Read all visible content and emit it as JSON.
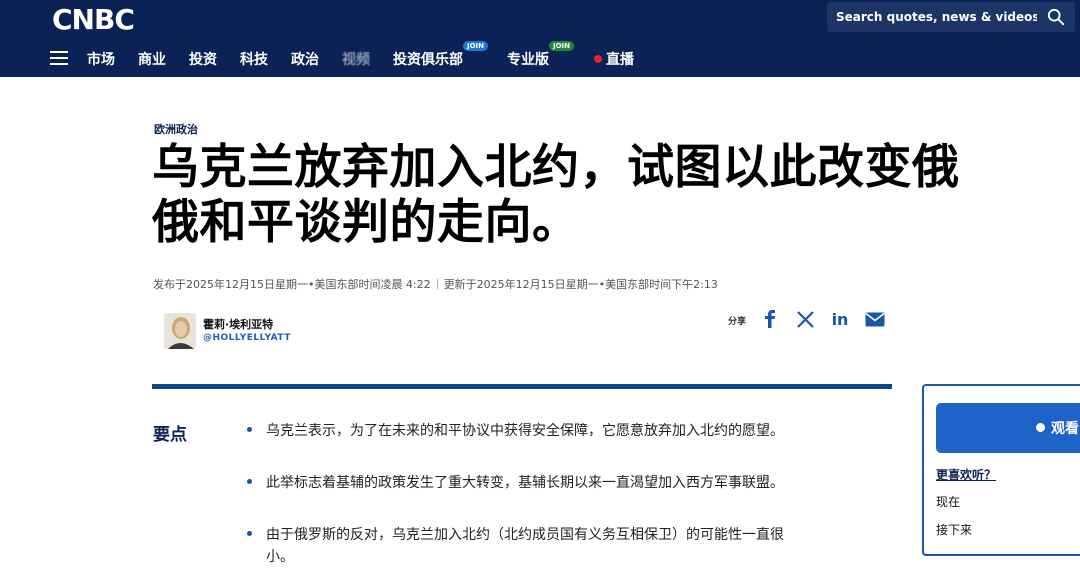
{
  "header": {
    "logo": "CNBC",
    "search_placeholder": "Search quotes, news & videos",
    "nav": [
      {
        "label": "市场"
      },
      {
        "label": "商业"
      },
      {
        "label": "投资"
      },
      {
        "label": "科技"
      },
      {
        "label": "政治"
      },
      {
        "label": "视频"
      },
      {
        "label": "投资俱乐部",
        "badge": "JOIN"
      },
      {
        "label": "专业版",
        "badge": "JOIN"
      },
      {
        "label": "直播"
      }
    ]
  },
  "article": {
    "category": "欧洲政治",
    "headline_line1": "乌克兰放弃加入北约，试图以此改变俄",
    "headline_line2": "俄和平谈判的走向。",
    "published": "发布于2025年12月15日星期一•美国东部时间凌晨 4:22",
    "updated": "更新于2025年12月15日星期一•美国东部时间下午2:13",
    "author_name": "霍莉·埃利亚特",
    "author_handle": "@HOLLYELLYATT",
    "share_label": "分享",
    "share_icons": [
      "facebook-icon",
      "x-icon",
      "linkedin-icon",
      "email-icon"
    ],
    "key_points_label": "要点",
    "key_points": [
      "乌克兰表示，为了在未来的和平协议中获得安全保障，它愿意放弃加入北约的愿望。",
      "此举标志着基辅的政策发生了重大转变，基辅长期以来一直渴望加入西方军事联盟。",
      "由于俄罗斯的反对，乌克兰加入北约（北约成员国有义务互相保卫）的可能性一直很",
      "小。"
    ]
  },
  "widget": {
    "watch_label": "观看",
    "link_more": "更喜欢听？",
    "link_now": "现在",
    "link_next": "接下来"
  },
  "colors": {
    "header_bg": "#0a2255",
    "accent": "#1d63c8",
    "divider": "#0a4a86"
  }
}
